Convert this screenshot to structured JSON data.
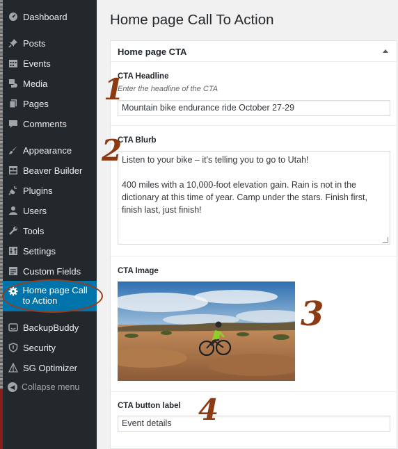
{
  "sidebar": {
    "items": [
      {
        "label": "Dashboard",
        "icon": "dashboard-icon"
      },
      {
        "label": "Posts",
        "icon": "pin-icon"
      },
      {
        "label": "Events",
        "icon": "calendar-icon"
      },
      {
        "label": "Media",
        "icon": "media-icon"
      },
      {
        "label": "Pages",
        "icon": "pages-icon"
      },
      {
        "label": "Comments",
        "icon": "comment-icon"
      },
      {
        "label": "Appearance",
        "icon": "paintbrush-icon"
      },
      {
        "label": "Beaver Builder",
        "icon": "layout-icon"
      },
      {
        "label": "Plugins",
        "icon": "plug-icon"
      },
      {
        "label": "Users",
        "icon": "user-icon"
      },
      {
        "label": "Tools",
        "icon": "wrench-icon"
      },
      {
        "label": "Settings",
        "icon": "sliders-icon"
      },
      {
        "label": "Custom Fields",
        "icon": "fields-icon"
      },
      {
        "label": "Home page Call to Action",
        "icon": "gear-icon"
      },
      {
        "label": "BackupBuddy",
        "icon": "backup-icon"
      },
      {
        "label": "Security",
        "icon": "shield-icon"
      },
      {
        "label": "SG Optimizer",
        "icon": "optimizer-icon"
      }
    ],
    "collapse_label": "Collapse menu"
  },
  "page": {
    "title": "Home page Call To Action"
  },
  "metabox": {
    "title": "Home page CTA"
  },
  "fields": {
    "headline": {
      "label": "CTA Headline",
      "description": "Enter the headline of the CTA",
      "value": "Mountain bike endurance ride October 27-29"
    },
    "blurb": {
      "label": "CTA Blurb",
      "value": "Listen to your bike – it's telling you to go to Utah!\n\n400 miles with a 10,000-foot elevation gain. Rain is not in the dictionary at this time of year. Camp under the stars. Finish first, finish last, just finish!"
    },
    "image": {
      "label": "CTA Image"
    },
    "button_label": {
      "label": "CTA button label",
      "value": "Event details"
    }
  },
  "annotations": [
    "1",
    "2",
    "3",
    "4"
  ],
  "colors": {
    "sidebar_bg": "#23282d",
    "active_bg": "#0073aa",
    "annotation": "#8b3a12",
    "page_bg": "#f1f1f1"
  }
}
